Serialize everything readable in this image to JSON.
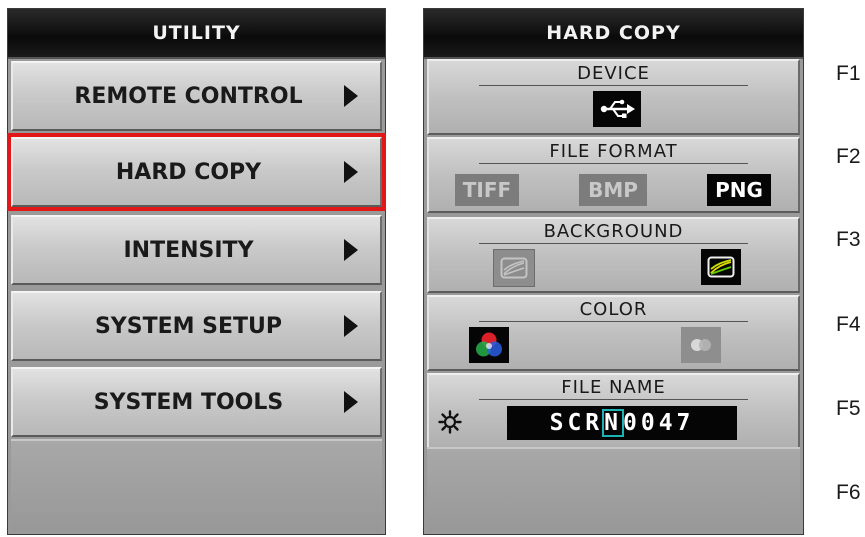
{
  "utility": {
    "title": "UTILITY",
    "items": [
      {
        "label": "REMOTE CONTROL"
      },
      {
        "label": "HARD COPY"
      },
      {
        "label": "INTENSITY"
      },
      {
        "label": "SYSTEM SETUP"
      },
      {
        "label": "SYSTEM TOOLS"
      }
    ],
    "selected_item": "HARD COPY"
  },
  "hard_copy": {
    "title": "HARD COPY",
    "device": {
      "title": "DEVICE",
      "icon": "usb-icon"
    },
    "file_format": {
      "title": "FILE FORMAT",
      "options": [
        "TIFF",
        "BMP",
        "PNG"
      ],
      "selected": "PNG"
    },
    "background": {
      "title": "BACKGROUND",
      "icons": [
        "background-light-icon",
        "background-dark-icon"
      ],
      "selected": "background-dark-icon"
    },
    "color": {
      "title": "COLOR",
      "icons": [
        "color-icon",
        "mono-icon"
      ],
      "selected": "color-icon"
    },
    "file_name": {
      "title": "FILE NAME",
      "prefix": "SCR",
      "cursor_char": "N",
      "suffix": "0047",
      "knob_icon": "adjust-knob-icon"
    }
  },
  "function_keys": [
    "F1",
    "F2",
    "F3",
    "F4",
    "F5",
    "F6"
  ],
  "colors": {
    "selection_outline": "#e01818",
    "cursor_outline": "#1bb3b3"
  }
}
